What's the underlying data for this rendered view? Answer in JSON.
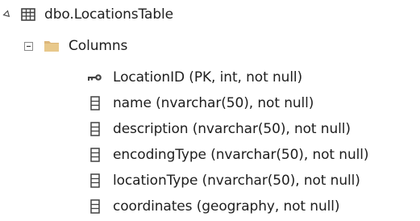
{
  "tree": {
    "table_node": {
      "label": "dbo.LocationsTable",
      "icon": "table-icon",
      "expanded": true
    },
    "columns_folder": {
      "label": "Columns",
      "icon": "folder-icon",
      "expanded": true
    },
    "columns": [
      {
        "label": "LocationID (PK, int, not null)",
        "icon": "primary-key-icon"
      },
      {
        "label": "name (nvarchar(50), not null)",
        "icon": "column-icon"
      },
      {
        "label": "description (nvarchar(50), not null)",
        "icon": "column-icon"
      },
      {
        "label": "encodingType (nvarchar(50), not null)",
        "icon": "column-icon"
      },
      {
        "label": "locationType (nvarchar(50), not null)",
        "icon": "column-icon"
      },
      {
        "label": "coordinates (geography, not null)",
        "icon": "column-icon"
      }
    ]
  },
  "colors": {
    "text": "#1e1e1e",
    "expander": "#4d4d4d",
    "folder": "#dcb67a",
    "icon": "#424242"
  }
}
